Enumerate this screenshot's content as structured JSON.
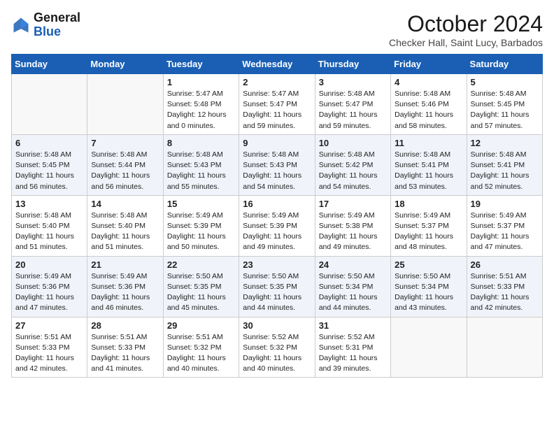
{
  "header": {
    "logo_line1": "General",
    "logo_line2": "Blue",
    "month_title": "October 2024",
    "location": "Checker Hall, Saint Lucy, Barbados"
  },
  "weekdays": [
    "Sunday",
    "Monday",
    "Tuesday",
    "Wednesday",
    "Thursday",
    "Friday",
    "Saturday"
  ],
  "weeks": [
    [
      {
        "day": "",
        "sunrise": "",
        "sunset": "",
        "daylight": ""
      },
      {
        "day": "",
        "sunrise": "",
        "sunset": "",
        "daylight": ""
      },
      {
        "day": "1",
        "sunrise": "Sunrise: 5:47 AM",
        "sunset": "Sunset: 5:48 PM",
        "daylight": "Daylight: 12 hours and 0 minutes."
      },
      {
        "day": "2",
        "sunrise": "Sunrise: 5:47 AM",
        "sunset": "Sunset: 5:47 PM",
        "daylight": "Daylight: 11 hours and 59 minutes."
      },
      {
        "day": "3",
        "sunrise": "Sunrise: 5:48 AM",
        "sunset": "Sunset: 5:47 PM",
        "daylight": "Daylight: 11 hours and 59 minutes."
      },
      {
        "day": "4",
        "sunrise": "Sunrise: 5:48 AM",
        "sunset": "Sunset: 5:46 PM",
        "daylight": "Daylight: 11 hours and 58 minutes."
      },
      {
        "day": "5",
        "sunrise": "Sunrise: 5:48 AM",
        "sunset": "Sunset: 5:45 PM",
        "daylight": "Daylight: 11 hours and 57 minutes."
      }
    ],
    [
      {
        "day": "6",
        "sunrise": "Sunrise: 5:48 AM",
        "sunset": "Sunset: 5:45 PM",
        "daylight": "Daylight: 11 hours and 56 minutes."
      },
      {
        "day": "7",
        "sunrise": "Sunrise: 5:48 AM",
        "sunset": "Sunset: 5:44 PM",
        "daylight": "Daylight: 11 hours and 56 minutes."
      },
      {
        "day": "8",
        "sunrise": "Sunrise: 5:48 AM",
        "sunset": "Sunset: 5:43 PM",
        "daylight": "Daylight: 11 hours and 55 minutes."
      },
      {
        "day": "9",
        "sunrise": "Sunrise: 5:48 AM",
        "sunset": "Sunset: 5:43 PM",
        "daylight": "Daylight: 11 hours and 54 minutes."
      },
      {
        "day": "10",
        "sunrise": "Sunrise: 5:48 AM",
        "sunset": "Sunset: 5:42 PM",
        "daylight": "Daylight: 11 hours and 54 minutes."
      },
      {
        "day": "11",
        "sunrise": "Sunrise: 5:48 AM",
        "sunset": "Sunset: 5:41 PM",
        "daylight": "Daylight: 11 hours and 53 minutes."
      },
      {
        "day": "12",
        "sunrise": "Sunrise: 5:48 AM",
        "sunset": "Sunset: 5:41 PM",
        "daylight": "Daylight: 11 hours and 52 minutes."
      }
    ],
    [
      {
        "day": "13",
        "sunrise": "Sunrise: 5:48 AM",
        "sunset": "Sunset: 5:40 PM",
        "daylight": "Daylight: 11 hours and 51 minutes."
      },
      {
        "day": "14",
        "sunrise": "Sunrise: 5:48 AM",
        "sunset": "Sunset: 5:40 PM",
        "daylight": "Daylight: 11 hours and 51 minutes."
      },
      {
        "day": "15",
        "sunrise": "Sunrise: 5:49 AM",
        "sunset": "Sunset: 5:39 PM",
        "daylight": "Daylight: 11 hours and 50 minutes."
      },
      {
        "day": "16",
        "sunrise": "Sunrise: 5:49 AM",
        "sunset": "Sunset: 5:39 PM",
        "daylight": "Daylight: 11 hours and 49 minutes."
      },
      {
        "day": "17",
        "sunrise": "Sunrise: 5:49 AM",
        "sunset": "Sunset: 5:38 PM",
        "daylight": "Daylight: 11 hours and 49 minutes."
      },
      {
        "day": "18",
        "sunrise": "Sunrise: 5:49 AM",
        "sunset": "Sunset: 5:37 PM",
        "daylight": "Daylight: 11 hours and 48 minutes."
      },
      {
        "day": "19",
        "sunrise": "Sunrise: 5:49 AM",
        "sunset": "Sunset: 5:37 PM",
        "daylight": "Daylight: 11 hours and 47 minutes."
      }
    ],
    [
      {
        "day": "20",
        "sunrise": "Sunrise: 5:49 AM",
        "sunset": "Sunset: 5:36 PM",
        "daylight": "Daylight: 11 hours and 47 minutes."
      },
      {
        "day": "21",
        "sunrise": "Sunrise: 5:49 AM",
        "sunset": "Sunset: 5:36 PM",
        "daylight": "Daylight: 11 hours and 46 minutes."
      },
      {
        "day": "22",
        "sunrise": "Sunrise: 5:50 AM",
        "sunset": "Sunset: 5:35 PM",
        "daylight": "Daylight: 11 hours and 45 minutes."
      },
      {
        "day": "23",
        "sunrise": "Sunrise: 5:50 AM",
        "sunset": "Sunset: 5:35 PM",
        "daylight": "Daylight: 11 hours and 44 minutes."
      },
      {
        "day": "24",
        "sunrise": "Sunrise: 5:50 AM",
        "sunset": "Sunset: 5:34 PM",
        "daylight": "Daylight: 11 hours and 44 minutes."
      },
      {
        "day": "25",
        "sunrise": "Sunrise: 5:50 AM",
        "sunset": "Sunset: 5:34 PM",
        "daylight": "Daylight: 11 hours and 43 minutes."
      },
      {
        "day": "26",
        "sunrise": "Sunrise: 5:51 AM",
        "sunset": "Sunset: 5:33 PM",
        "daylight": "Daylight: 11 hours and 42 minutes."
      }
    ],
    [
      {
        "day": "27",
        "sunrise": "Sunrise: 5:51 AM",
        "sunset": "Sunset: 5:33 PM",
        "daylight": "Daylight: 11 hours and 42 minutes."
      },
      {
        "day": "28",
        "sunrise": "Sunrise: 5:51 AM",
        "sunset": "Sunset: 5:33 PM",
        "daylight": "Daylight: 11 hours and 41 minutes."
      },
      {
        "day": "29",
        "sunrise": "Sunrise: 5:51 AM",
        "sunset": "Sunset: 5:32 PM",
        "daylight": "Daylight: 11 hours and 40 minutes."
      },
      {
        "day": "30",
        "sunrise": "Sunrise: 5:52 AM",
        "sunset": "Sunset: 5:32 PM",
        "daylight": "Daylight: 11 hours and 40 minutes."
      },
      {
        "day": "31",
        "sunrise": "Sunrise: 5:52 AM",
        "sunset": "Sunset: 5:31 PM",
        "daylight": "Daylight: 11 hours and 39 minutes."
      },
      {
        "day": "",
        "sunrise": "",
        "sunset": "",
        "daylight": ""
      },
      {
        "day": "",
        "sunrise": "",
        "sunset": "",
        "daylight": ""
      }
    ]
  ]
}
